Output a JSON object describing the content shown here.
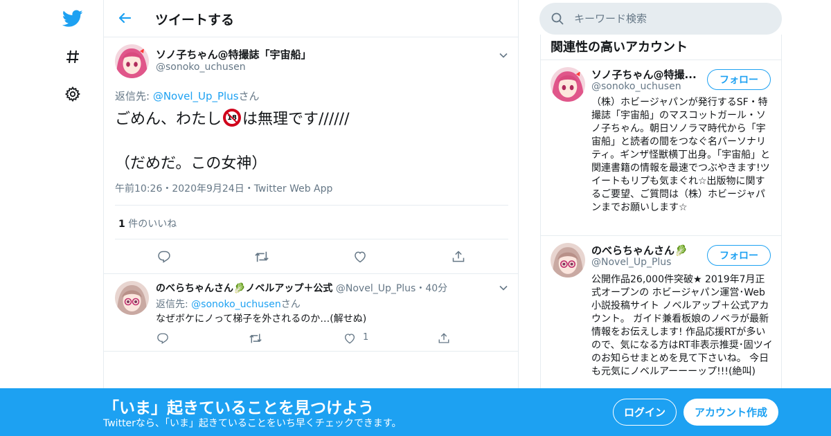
{
  "colors": {
    "accent": "#1da1f2",
    "muted": "#657786",
    "border": "#e6ecf0"
  },
  "nav": {
    "icons": [
      "twitter-logo-icon",
      "hashtag-icon",
      "gear-icon"
    ]
  },
  "header": {
    "title": "ツイートする"
  },
  "main_tweet": {
    "name": "ソノ子ちゃん@特撮誌「宇宙船」",
    "handle": "@sonoko_uchusen",
    "reply_to_prefix": "返信先: ",
    "reply_to_user": "@Novel_Up_Plus",
    "reply_to_suffix": "さん",
    "text_before": "ごめん、わたし",
    "r18_badge": "18",
    "text_after": "は無理です//////",
    "text_line2": "（だめだ。この女神）",
    "timestamp": "午前10:26・2020年9月24日・Twitter Web App",
    "likes_count": "1",
    "likes_label": " 件のいいね"
  },
  "reply_tweet": {
    "name": "のべらちゃんさん🥬ノベルアップ＋公式",
    "handle": "@Novel_Up_Plus",
    "time": "・40分",
    "reply_to_prefix": "返信先: ",
    "reply_to_user": "@sonoko_uchusen",
    "reply_to_suffix": "さん",
    "text": "なぜボケにノって梯子を外されるのか…(解せぬ)",
    "like_count": "1"
  },
  "search": {
    "placeholder": "キーワード検索"
  },
  "related": {
    "title": "関連性の高いアカウント",
    "follow_label": "フォロー",
    "accounts": [
      {
        "name": "ソノ子ちゃん@特撮...",
        "handle": "@sonoko_uchusen",
        "bio": "（株）ホビージャパンが発行するSF・特撮誌「宇宙船」のマスコットガール・ソノ子ちゃん。朝日ソノラマ時代から「宇宙船」と読者の間をつなぐ名パーソナリティ。ギンザ怪獣横丁出身。「宇宙船」と関連書籍の情報を最速でつぶやきます!ツイートもリプも気まぐれ☆出版物に関するご要望、ご質問は（株）ホビージャパンまでお願いします☆"
      },
      {
        "name": "のべらちゃんさん🥬",
        "handle": "@Novel_Up_Plus",
        "bio": "公開作品26,000件突破★ 2019年7月正式オープンの ホビージャパン運営･Web小説投稿サイト ノベルアップ＋公式アカウント。 ガイド兼看板娘のノベラが最新情報をお伝えします! 作品応援RTが多いので、気になる方はRT非表示推奨･固ツイのお知らせまとめを見て下さいね。 今日も元気にノベルアーーーップ!!!(絶叫)"
      }
    ]
  },
  "banner": {
    "title": "「いま」起きていることを見つけよう",
    "subtitle": "Twitterなら、「いま」起きていることをいち早くチェックできます。",
    "login_label": "ログイン",
    "signup_label": "アカウント作成"
  }
}
